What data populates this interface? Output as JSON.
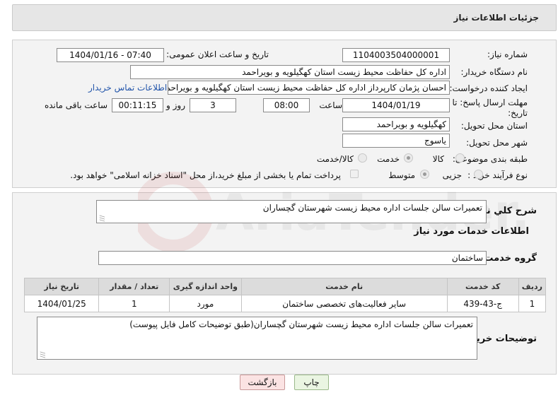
{
  "header": {
    "title": "جزئیات اطلاعات نیاز"
  },
  "fields": {
    "need_number_label": "شماره نیاز:",
    "need_number": "1104003504000001",
    "announce_label": "تاریخ و ساعت اعلان عمومی:",
    "announce_value": "1404/01/16 - 07:40",
    "buyer_org_label": "نام دستگاه خریدار:",
    "buyer_org": "اداره کل حفاظت محیط زیست استان کهگیلویه و بویراحمد",
    "creator_label": "ایجاد کننده درخواست:",
    "creator": "احسان پژمان کارپرداز اداره کل حفاظت محیط زیست استان کهگیلویه و بویراحمد",
    "contact_link": "اطلاعات تماس خریدار",
    "deadline_label": "مهلت ارسال پاسخ: تا تاریخ:",
    "deadline_date": "1404/01/19",
    "time_label": "ساعت",
    "deadline_time": "08:00",
    "days_value": "3",
    "days_label": "روز و",
    "remaining_time": "00:11:15",
    "remaining_label": "ساعت باقی مانده",
    "province_label": "استان محل تحویل:",
    "province": "کهگیلویه و بویراحمد",
    "city_label": "شهر محل تحویل:",
    "city": "یاسوج",
    "category_label": "طبقه بندی موضوعی:",
    "category_options": [
      "کالا",
      "خدمت",
      "کالا/خدمت"
    ],
    "category_selected": "خدمت",
    "process_label": "نوع فرآیند خرید :",
    "process_options": [
      "جزیی",
      "متوسط"
    ],
    "process_selected": "متوسط",
    "payment_note": "پرداخت تمام یا بخشی از مبلغ خرید،از محل \"اسناد خزانه اسلامی\" خواهد بود."
  },
  "description": {
    "label": "شرح کلي نياز:",
    "value": "تعمیرات سالن جلسات اداره محیط زیست شهرستان گچساران"
  },
  "services": {
    "section_title": "اطلاعات خدمات مورد نیاز",
    "group_label": "گروه خدمت:",
    "group_value": "ساختمان",
    "columns": [
      "ردیف",
      "کد خدمت",
      "نام خدمت",
      "واحد اندازه گیری",
      "تعداد / مقدار",
      "تاریخ نیاز"
    ],
    "rows": [
      [
        "1",
        "ج-43-439",
        "سایر فعالیت‌های تخصصی ساختمان",
        "مورد",
        "1",
        "1404/01/25"
      ]
    ]
  },
  "buyer_notes": {
    "label": "توضیحات خریدار:",
    "value": "تعمیرات سالن جلسات اداره محیط زیست شهرستان گچساران(طبق توضیحات کامل فایل پیوست)"
  },
  "buttons": {
    "print": "چاپ",
    "back": "بازگشت"
  },
  "watermark": {
    "text": "AriaTender.net"
  }
}
